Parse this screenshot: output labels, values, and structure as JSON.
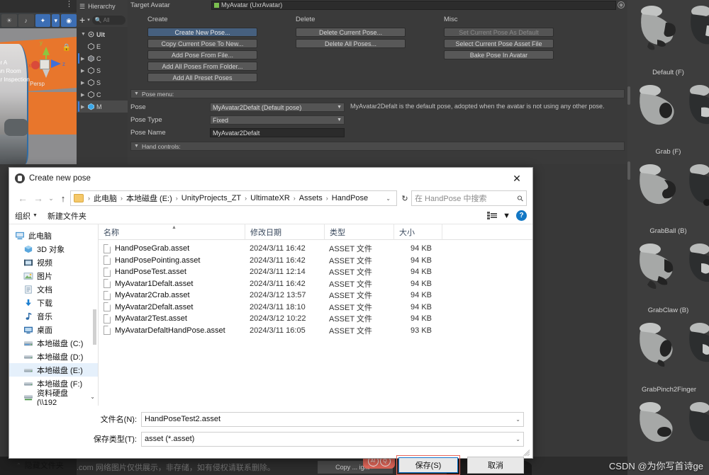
{
  "unity": {
    "scene": {
      "labels": [
        "or A",
        "wn Room",
        "ar Inspection"
      ],
      "persp": "Persp",
      "axis_y": "y",
      "axis_x": "x",
      "axis_z": "z"
    },
    "hierarchy": {
      "title": "Hierarchy",
      "search_placeholder": "All",
      "root": "Ult",
      "items": [
        "E",
        "C",
        "S",
        "S",
        "C",
        "M"
      ]
    },
    "inspector": {
      "target_avatar_label": "Target Avatar",
      "target_avatar_value": "MyAvatar (UxrAvatar)",
      "create_title": "Create",
      "create_buttons": [
        "Create New Pose...",
        "Copy Current Pose To New...",
        "Add Pose From File...",
        "Add All Poses From Folder...",
        "Add All Preset Poses"
      ],
      "delete_title": "Delete",
      "delete_buttons": [
        "Delete Current Pose...",
        "Delete All Poses..."
      ],
      "misc_title": "Misc",
      "misc_buttons": [
        "Set Current Pose As Default",
        "Select Current Pose Asset File",
        "Bake Pose In Avatar"
      ],
      "pose_menu_bar": "Pose menu:",
      "pose_label": "Pose",
      "pose_value": "MyAvatar2Defalt (Default pose)",
      "pose_help": "MyAvatar2Defalt is the default pose, adopted when the avatar is not using any other pose.",
      "pose_type_label": "Pose Type",
      "pose_type_value": "Fixed",
      "pose_name_label": "Pose Name",
      "pose_name_value": "MyAvatar2Defalt",
      "hand_controls_bar": "Hand controls:"
    },
    "gallery": [
      {
        "label": "Default (F)"
      },
      {
        "label": "Grab (F)"
      },
      {
        "label": "GrabBall (B)"
      },
      {
        "label": "GrabClaw (B)"
      },
      {
        "label": "GrabPinch2Finger"
      },
      {
        "label": ""
      }
    ],
    "bottom": {
      "disclaimer": ".com 网络图片仅供展示，非存储，如有侵权请联系删除。",
      "copy_button": "Copy  ...  ight >",
      "ai_badge": "AI",
      "watermark": "CSDN @为你写首诗ge"
    },
    "colors": {
      "accent_blue": "#46607f",
      "panel_bg": "#3a3a3a",
      "selection": "#3b80e0"
    }
  },
  "dialog": {
    "title": "Create new pose",
    "close_label": "✕",
    "nav": {
      "back": "←",
      "forward": "→",
      "recent": "⌄",
      "up": "↑",
      "refresh": "↻",
      "breadcrumbs": [
        "此电脑",
        "本地磁盘 (E:)",
        "UnityProjects_ZT",
        "UltimateXR",
        "Assets",
        "HandPose"
      ],
      "crumb_separator": "›",
      "search_placeholder": "在 HandPose 中搜索"
    },
    "commands": {
      "organize": "组织",
      "new_folder": "新建文件夹",
      "help": "?"
    },
    "sidebar": [
      {
        "label": "此电脑",
        "icon": "computer-icon",
        "level": 0,
        "selected": false
      },
      {
        "label": "3D 对象",
        "icon": "3d-objects-icon",
        "level": 1,
        "selected": false
      },
      {
        "label": "视频",
        "icon": "videos-icon",
        "level": 1,
        "selected": false
      },
      {
        "label": "图片",
        "icon": "pictures-icon",
        "level": 1,
        "selected": false
      },
      {
        "label": "文档",
        "icon": "documents-icon",
        "level": 1,
        "selected": false
      },
      {
        "label": "下载",
        "icon": "downloads-icon",
        "level": 1,
        "selected": false
      },
      {
        "label": "音乐",
        "icon": "music-icon",
        "level": 1,
        "selected": false
      },
      {
        "label": "桌面",
        "icon": "desktop-icon",
        "level": 1,
        "selected": false
      },
      {
        "label": "本地磁盘 (C:)",
        "icon": "drive-system-icon",
        "level": 1,
        "selected": false
      },
      {
        "label": "本地磁盘 (D:)",
        "icon": "drive-icon",
        "level": 1,
        "selected": false
      },
      {
        "label": "本地磁盘 (E:)",
        "icon": "drive-icon",
        "level": 1,
        "selected": true
      },
      {
        "label": "本地磁盘 (F:)",
        "icon": "drive-icon",
        "level": 1,
        "selected": false
      },
      {
        "label": "资料硬盘 (\\\\192",
        "icon": "network-drive-icon",
        "level": 1,
        "selected": false
      }
    ],
    "columns": [
      "名称",
      "修改日期",
      "类型",
      "大小"
    ],
    "files": [
      {
        "name": "HandPoseGrab.asset",
        "modified": "2024/3/11 16:42",
        "type": "ASSET 文件",
        "size": "94 KB"
      },
      {
        "name": "HandPosePointing.asset",
        "modified": "2024/3/11 16:42",
        "type": "ASSET 文件",
        "size": "94 KB"
      },
      {
        "name": "HandPoseTest.asset",
        "modified": "2024/3/11 12:14",
        "type": "ASSET 文件",
        "size": "94 KB"
      },
      {
        "name": "MyAvatar1Defalt.asset",
        "modified": "2024/3/11 16:42",
        "type": "ASSET 文件",
        "size": "94 KB"
      },
      {
        "name": "MyAvatar2Crab.asset",
        "modified": "2024/3/12 13:57",
        "type": "ASSET 文件",
        "size": "94 KB"
      },
      {
        "name": "MyAvatar2Defalt.asset",
        "modified": "2024/3/11 18:10",
        "type": "ASSET 文件",
        "size": "94 KB"
      },
      {
        "name": "MyAvatar2Test.asset",
        "modified": "2024/3/12 10:22",
        "type": "ASSET 文件",
        "size": "94 KB"
      },
      {
        "name": "MyAvatarDefaltHandPose.asset",
        "modified": "2024/3/11 16:05",
        "type": "ASSET 文件",
        "size": "93 KB"
      }
    ],
    "footer": {
      "filename_label": "文件名(N):",
      "filename_value": "HandPoseTest2.asset",
      "savetype_label": "保存类型(T):",
      "savetype_value": "asset (*.asset)",
      "hide_folders": "隐藏文件夹",
      "save_button": "保存(S)",
      "cancel_button": "取消"
    }
  }
}
